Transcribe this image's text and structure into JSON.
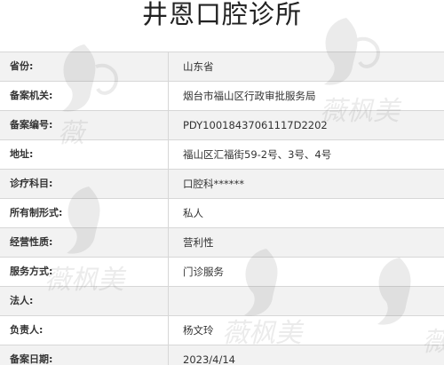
{
  "page": {
    "title": "井恩口腔诊所"
  },
  "rows": [
    {
      "label": "省份:",
      "value": "山东省"
    },
    {
      "label": "备案机关:",
      "value": "烟台市福山区行政审批服务局"
    },
    {
      "label": "备案编号:",
      "value": "PDY10018437061117D2202"
    },
    {
      "label": "地址:",
      "value": "福山区汇福街59-2号、3号、4号"
    },
    {
      "label": "诊疗科目:",
      "value": "口腔科******"
    },
    {
      "label": "所有制形式:",
      "value": "私人"
    },
    {
      "label": "经营性质:",
      "value": "营利性"
    },
    {
      "label": "服务方式:",
      "value": "门诊服务"
    },
    {
      "label": "法人:",
      "value": ""
    },
    {
      "label": "负责人:",
      "value": "杨文玲"
    },
    {
      "label": "备案日期:",
      "value": "2023/4/14"
    }
  ],
  "watermark": {
    "text": "薇枫美",
    "color": "#6a6a6a"
  }
}
